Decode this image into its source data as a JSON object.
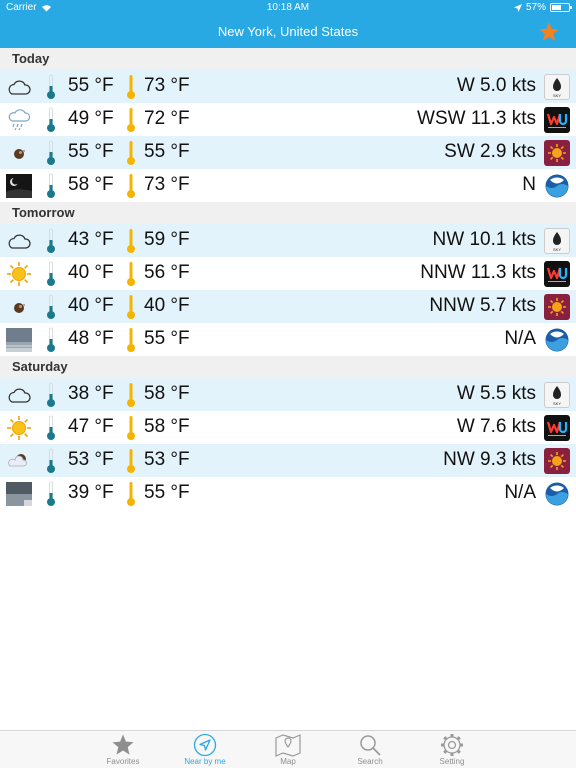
{
  "status": {
    "carrier": "Carrier",
    "time": "10:18 AM",
    "battery": "57%"
  },
  "header": {
    "title": "New York, United States"
  },
  "sections": [
    {
      "label": "Today",
      "rows": [
        {
          "icon": "cloudy",
          "low": "55 °F",
          "high": "73 °F",
          "wind": "W 5.0 kts",
          "provider": "darksky"
        },
        {
          "icon": "rain",
          "low": "49 °F",
          "high": "72 °F",
          "wind": "WSW 11.3 kts",
          "provider": "wunderground"
        },
        {
          "icon": "night",
          "low": "55 °F",
          "high": "55 °F",
          "wind": "SW 2.9 kts",
          "provider": "openweather"
        },
        {
          "icon": "moon-photo",
          "low": "58 °F",
          "high": "73 °F",
          "wind": "N",
          "provider": "noaa"
        }
      ]
    },
    {
      "label": "Tomorrow",
      "rows": [
        {
          "icon": "cloudy",
          "low": "43 °F",
          "high": "59 °F",
          "wind": "NW 10.1 kts",
          "provider": "darksky"
        },
        {
          "icon": "sunny",
          "low": "40 °F",
          "high": "56 °F",
          "wind": "NNW 11.3 kts",
          "provider": "wunderground"
        },
        {
          "icon": "night",
          "low": "40 °F",
          "high": "40 °F",
          "wind": "NNW 5.7 kts",
          "provider": "openweather"
        },
        {
          "icon": "cloud-photo",
          "low": "48 °F",
          "high": "55 °F",
          "wind": "N/A",
          "provider": "noaa"
        }
      ]
    },
    {
      "label": "Saturday",
      "rows": [
        {
          "icon": "cloudy",
          "low": "38 °F",
          "high": "58 °F",
          "wind": "W 5.5 kts",
          "provider": "darksky"
        },
        {
          "icon": "sunny",
          "low": "47 °F",
          "high": "58 °F",
          "wind": "W 7.6 kts",
          "provider": "wunderground"
        },
        {
          "icon": "partly-cloudy",
          "low": "53 °F",
          "high": "53 °F",
          "wind": "NW 9.3 kts",
          "provider": "openweather"
        },
        {
          "icon": "overcast-photo",
          "low": "39 °F",
          "high": "55 °F",
          "wind": "N/A",
          "provider": "noaa"
        }
      ]
    }
  ],
  "tabs": [
    {
      "label": "Favorites",
      "icon": "star-icon",
      "active": false
    },
    {
      "label": "Near by me",
      "icon": "location-icon",
      "active": true
    },
    {
      "label": "Map",
      "icon": "map-icon",
      "active": false
    },
    {
      "label": "Search",
      "icon": "search-icon",
      "active": false
    },
    {
      "label": "Setting",
      "icon": "gear-icon",
      "active": false
    }
  ],
  "colors": {
    "accent": "#29a9e3",
    "alt_row": "#e3f3fb",
    "star": "#f5821f",
    "hot": "#f5b400",
    "cold": "#1a7a8c"
  }
}
